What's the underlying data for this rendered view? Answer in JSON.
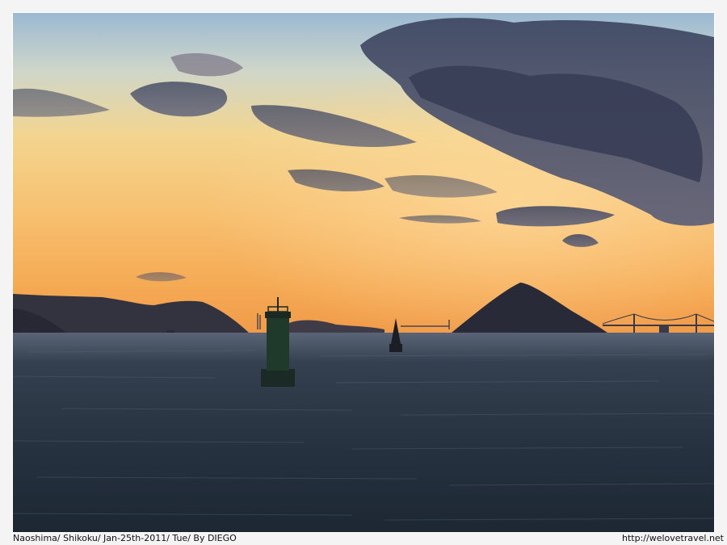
{
  "photo": {
    "scene": "sunset-seascape",
    "palette": {
      "sky_top": "#8fb3cf",
      "sky_mid": "#f4c978",
      "sky_low": "#f6a94f",
      "cloud": "#4c5472",
      "island": "#2b2c3a",
      "sea": "#24303f",
      "beacon": "#1f3a2a"
    }
  },
  "caption": {
    "left_text": "Naoshima/ Shikoku/ Jan-25th-2011/ Tue/ By DIEGO",
    "right_text": "http://welovetravel.net"
  }
}
